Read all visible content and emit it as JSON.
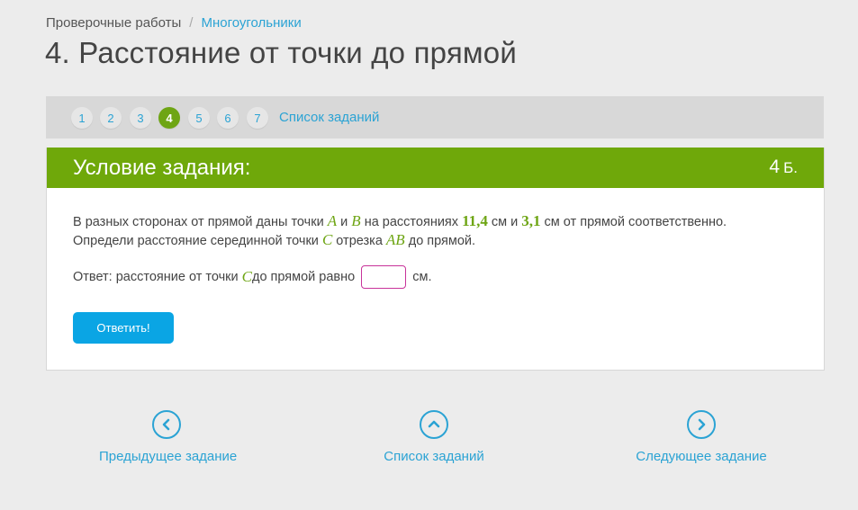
{
  "breadcrumb": {
    "first": "Проверочные работы",
    "separator": "/",
    "second": "Многоугольники"
  },
  "page_title": "4. Расстояние от точки до прямой",
  "pager": {
    "numbers": [
      "1",
      "2",
      "3",
      "4",
      "5",
      "6",
      "7"
    ],
    "active": "4",
    "list_link": "Список заданий"
  },
  "task": {
    "header": "Условие задания:",
    "points": "4",
    "points_unit": "Б.",
    "line1": {
      "t1": "В разных сторонах от прямой даны точки ",
      "m1": "A",
      "t2": " и ",
      "m2": "B",
      "t3": " на расстояниях ",
      "n1": "11,4",
      "t4": " см и ",
      "n2": "3,1",
      "t5": " см от прямой соответственно."
    },
    "line2": {
      "t1": "Определи расстояние серединной точки ",
      "m1": "C",
      "t2": " отрезка ",
      "m2": "AB",
      "t3": " до прямой."
    },
    "answer": {
      "prefix": "Ответ: расстояние от точки ",
      "var": "C",
      "middle": " до прямой равно",
      "input_value": "",
      "unit": "см."
    },
    "submit_label": "Ответить!"
  },
  "bottom_nav": {
    "prev": "Предыдущее задание",
    "list": "Список заданий",
    "next": "Следующее задание"
  },
  "colors": {
    "accent_green": "#6fa80a",
    "link_blue": "#2ba3d4",
    "button_blue": "#0aa5e4",
    "input_border": "#c8339a"
  },
  "icons": {
    "prev": "chevron-left-circle-icon",
    "list": "chevron-up-circle-icon",
    "next": "chevron-right-circle-icon"
  }
}
